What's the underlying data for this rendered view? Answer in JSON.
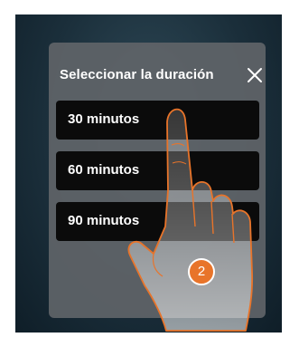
{
  "dialog": {
    "title": "Seleccionar la duración",
    "close_icon": "close-icon",
    "options": [
      {
        "label": "30 minutos"
      },
      {
        "label": "60 minutos"
      },
      {
        "label": "90 minutos"
      }
    ]
  },
  "overlay": {
    "step_number": "2",
    "hand_icon": "pointing-hand-icon",
    "accent_color": "#e8742a"
  }
}
